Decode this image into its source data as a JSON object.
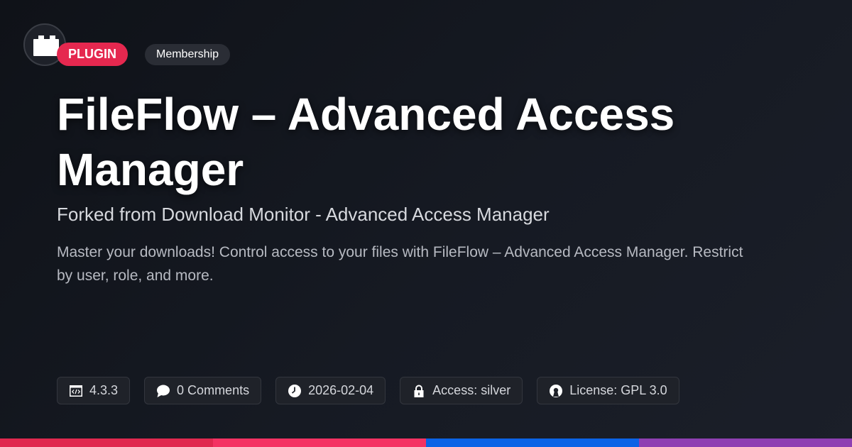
{
  "header": {
    "type_tag": "PLUGIN",
    "category_tag": "Membership"
  },
  "title": "FileFlow – Advanced Access Manager",
  "subtitle": "Forked from Download Monitor - Advanced Access Manager",
  "description": "Master your downloads! Control access to your files with FileFlow – Advanced Access Manager. Restrict by user, role, and more.",
  "meta": {
    "version": "4.3.3",
    "comments": "0 Comments",
    "date": "2026-02-04",
    "access": "Access: silver",
    "license": "License: GPL 3.0"
  },
  "icons": {
    "logo": "plugin-box-icon",
    "version": "code-icon",
    "comments": "speech-bubble-icon",
    "date": "clock-icon",
    "access": "lock-icon",
    "license": "open-source-icon"
  },
  "colors": {
    "accent_red": "#e5284f",
    "bar": [
      "#e0284f",
      "#f43263",
      "#0b63e6",
      "#8e3fb2"
    ]
  }
}
